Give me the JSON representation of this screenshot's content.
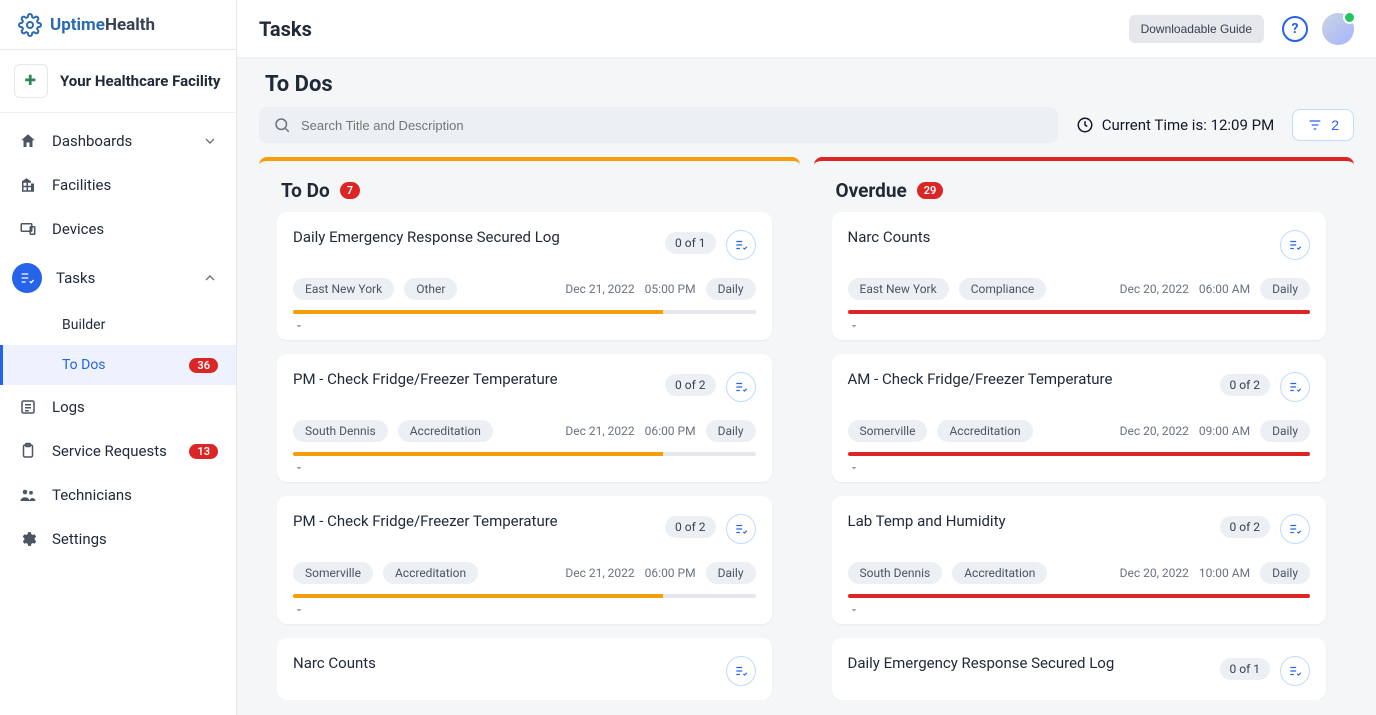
{
  "brand": {
    "part1": "Uptime",
    "part2": "Health"
  },
  "facility": {
    "name": "Your Healthcare Facility",
    "logo_text": "✚"
  },
  "sidebar": {
    "dashboards": "Dashboards",
    "facilities": "Facilities",
    "devices": "Devices",
    "tasks": "Tasks",
    "builder": "Builder",
    "todos": "To Dos",
    "todos_badge": "36",
    "logs": "Logs",
    "service_requests": "Service Requests",
    "service_requests_badge": "13",
    "technicians": "Technicians",
    "settings": "Settings"
  },
  "topbar": {
    "title": "Tasks",
    "guide": "Downloadable Guide"
  },
  "section_title": "To Dos",
  "search_placeholder": "Search Title and Description",
  "current_time_label": "Current Time is: ",
  "current_time_value": "12:09 PM",
  "filter_count": "2",
  "columns": {
    "todo": {
      "title": "To Do",
      "count": "7"
    },
    "overdue": {
      "title": "Overdue",
      "count": "29"
    }
  },
  "todo_cards": [
    {
      "title": "Daily Emergency Response Secured Log",
      "count": "0 of 1",
      "tags": [
        "East New York",
        "Other"
      ],
      "date": "Dec 21, 2022",
      "time": "05:00 PM",
      "freq": "Daily",
      "progress": 80
    },
    {
      "title": "PM - Check Fridge/Freezer Temperature",
      "count": "0 of 2",
      "tags": [
        "South Dennis",
        "Accreditation"
      ],
      "date": "Dec 21, 2022",
      "time": "06:00 PM",
      "freq": "Daily",
      "progress": 80
    },
    {
      "title": "PM - Check Fridge/Freezer Temperature",
      "count": "0 of 2",
      "tags": [
        "Somerville",
        "Accreditation"
      ],
      "date": "Dec 21, 2022",
      "time": "06:00 PM",
      "freq": "Daily",
      "progress": 80
    },
    {
      "title": "Narc Counts",
      "count": "",
      "tags": [],
      "date": "",
      "time": "",
      "freq": "",
      "progress": 0
    }
  ],
  "overdue_cards": [
    {
      "title": "Narc Counts",
      "count": "",
      "tags": [
        "East New York",
        "Compliance"
      ],
      "date": "Dec 20, 2022",
      "time": "06:00 AM",
      "freq": "Daily",
      "progress": 100
    },
    {
      "title": "AM - Check Fridge/Freezer Temperature",
      "count": "0 of 2",
      "tags": [
        "Somerville",
        "Accreditation"
      ],
      "date": "Dec 20, 2022",
      "time": "09:00 AM",
      "freq": "Daily",
      "progress": 100
    },
    {
      "title": "Lab Temp and Humidity",
      "count": "0 of 2",
      "tags": [
        "South Dennis",
        "Accreditation"
      ],
      "date": "Dec 20, 2022",
      "time": "10:00 AM",
      "freq": "Daily",
      "progress": 100
    },
    {
      "title": "Daily Emergency Response Secured Log",
      "count": "0 of 1",
      "tags": [],
      "date": "",
      "time": "",
      "freq": "",
      "progress": 0
    }
  ]
}
